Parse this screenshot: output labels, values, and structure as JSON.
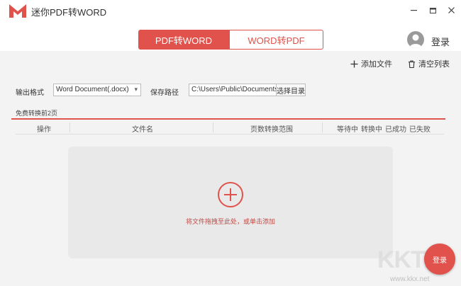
{
  "app": {
    "title": "迷你PDF转WORD",
    "logo_letter": "M",
    "brand_color": "#e0524b"
  },
  "window_controls": {
    "minimize_icon": "minimize-icon",
    "restore_icon": "restore-icon",
    "close_icon": "close-icon"
  },
  "tabs": [
    {
      "label": "PDF转WORD",
      "active": true
    },
    {
      "label": "WORD转PDF",
      "active": false
    }
  ],
  "user": {
    "login_label": "登录",
    "avatar_icon": "user-avatar-icon"
  },
  "toolbar": {
    "add_file_label": "添加文件",
    "clear_list_label": "清空列表"
  },
  "settings": {
    "output_format_label": "输出格式",
    "output_format_value": "Word Document(.docx)",
    "save_path_label": "保存路径",
    "save_path_value": "C:\\Users\\Public\\Documents",
    "choose_dir_label": "选择目录"
  },
  "free_note": "免费转换前2页",
  "table": {
    "columns": [
      "操作",
      "文件名",
      "页数转换范围",
      "等待中",
      "转换中",
      "已成功",
      "已失败"
    ]
  },
  "dropzone": {
    "hint": "将文件拖拽至此处，或单击添加"
  },
  "float_button": {
    "label": "登录"
  },
  "watermark": {
    "text": "KKTX",
    "url": "www.kkx.net"
  }
}
